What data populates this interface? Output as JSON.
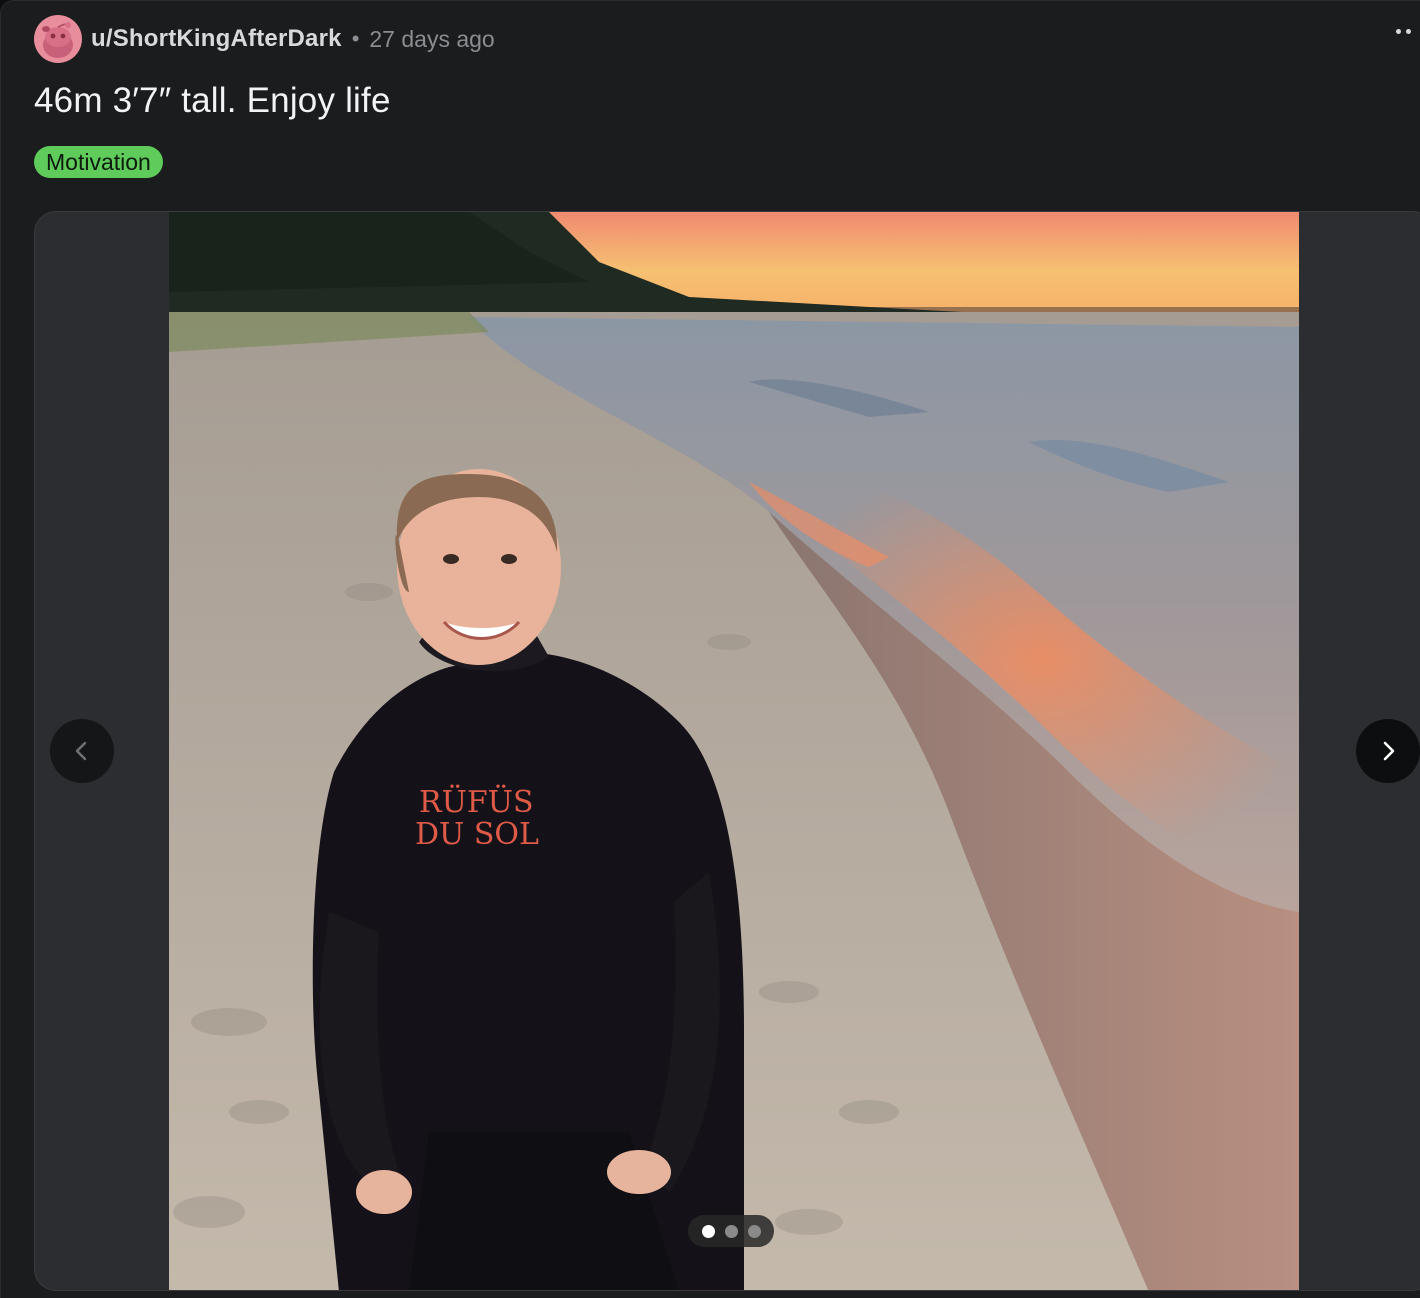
{
  "post": {
    "author": "u/ShortKingAfterDark",
    "separator": "•",
    "age": "27 days ago",
    "title": "46m 3′7″ tall. Enjoy life",
    "flair": "Motivation"
  },
  "gallery": {
    "image_alt": "Smiling man in a black hoodie kneeling on a sandy beach at sunset",
    "hoodie_text_line1": "RÜFÜS",
    "hoodie_text_line2": "DU SOL",
    "current_index": 1,
    "total_images": 3
  },
  "colors": {
    "flair_bg": "#5ecb5b",
    "card_bg": "#1b1c1e",
    "avatar_bg": "#e88d9c"
  },
  "icons": {
    "avatar": "reddit-snoo-avatar-icon",
    "more": "more-options-icon",
    "prev": "chevron-left-icon",
    "next": "chevron-right-icon"
  }
}
